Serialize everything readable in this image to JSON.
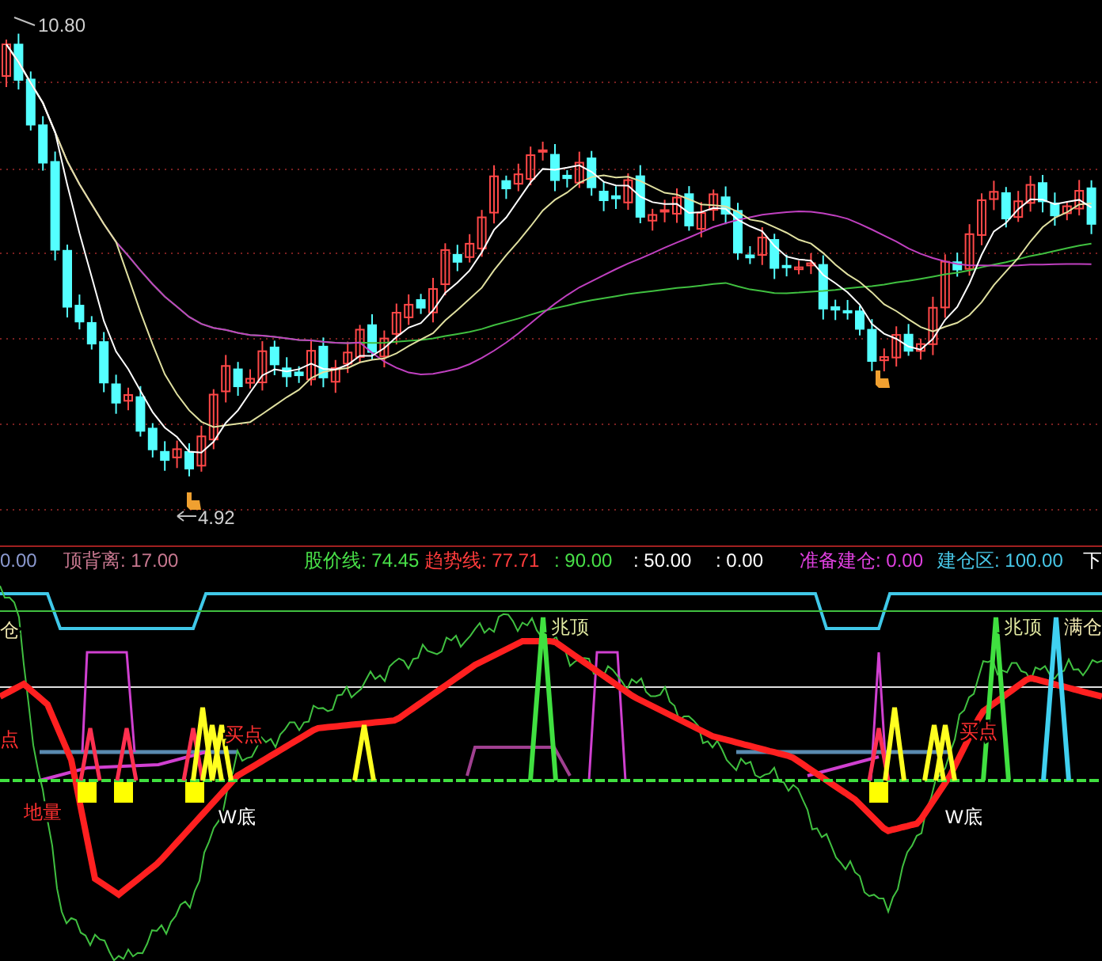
{
  "price_chart": {
    "high_label": "10.80",
    "low_label": "4.92"
  },
  "indicator_header": [
    {
      "text": "0.00",
      "color": "#8c9ad0"
    },
    {
      "text": "顶背离: 17.00",
      "color": "#c87890"
    },
    {
      "text": "股价线: 74.45",
      "color": "#48e048"
    },
    {
      "text": "趋势线: 77.71",
      "color": "#ff3c3c"
    },
    {
      "text": ": 90.00",
      "color": "#48e048"
    },
    {
      "text": ": 50.00",
      "color": "#ffffff"
    },
    {
      "text": ": 0.00",
      "color": "#ffffff"
    },
    {
      "text": "准备建仓: 0.00",
      "color": "#e040e0"
    },
    {
      "text": "建仓区: 100.00",
      "color": "#48c8e8"
    },
    {
      "text": "下",
      "color": "#ffffff"
    }
  ],
  "indicator_labels": [
    {
      "text": "仓",
      "color": "#f0e8b0"
    },
    {
      "text": "兆顶",
      "color": "#e0e8a0"
    },
    {
      "text": "兆顶",
      "color": "#e0e8a0"
    },
    {
      "text": "满仓",
      "color": "#f0e8b0"
    },
    {
      "text": "点",
      "color": "#ff3030"
    },
    {
      "text": "买点",
      "color": "#ff3030"
    },
    {
      "text": "买点",
      "color": "#ff3030"
    },
    {
      "text": "地量",
      "color": "#ff3030"
    },
    {
      "text": "W底",
      "color": "#ffffff"
    },
    {
      "text": "W底",
      "color": "#ffffff"
    }
  ]
}
